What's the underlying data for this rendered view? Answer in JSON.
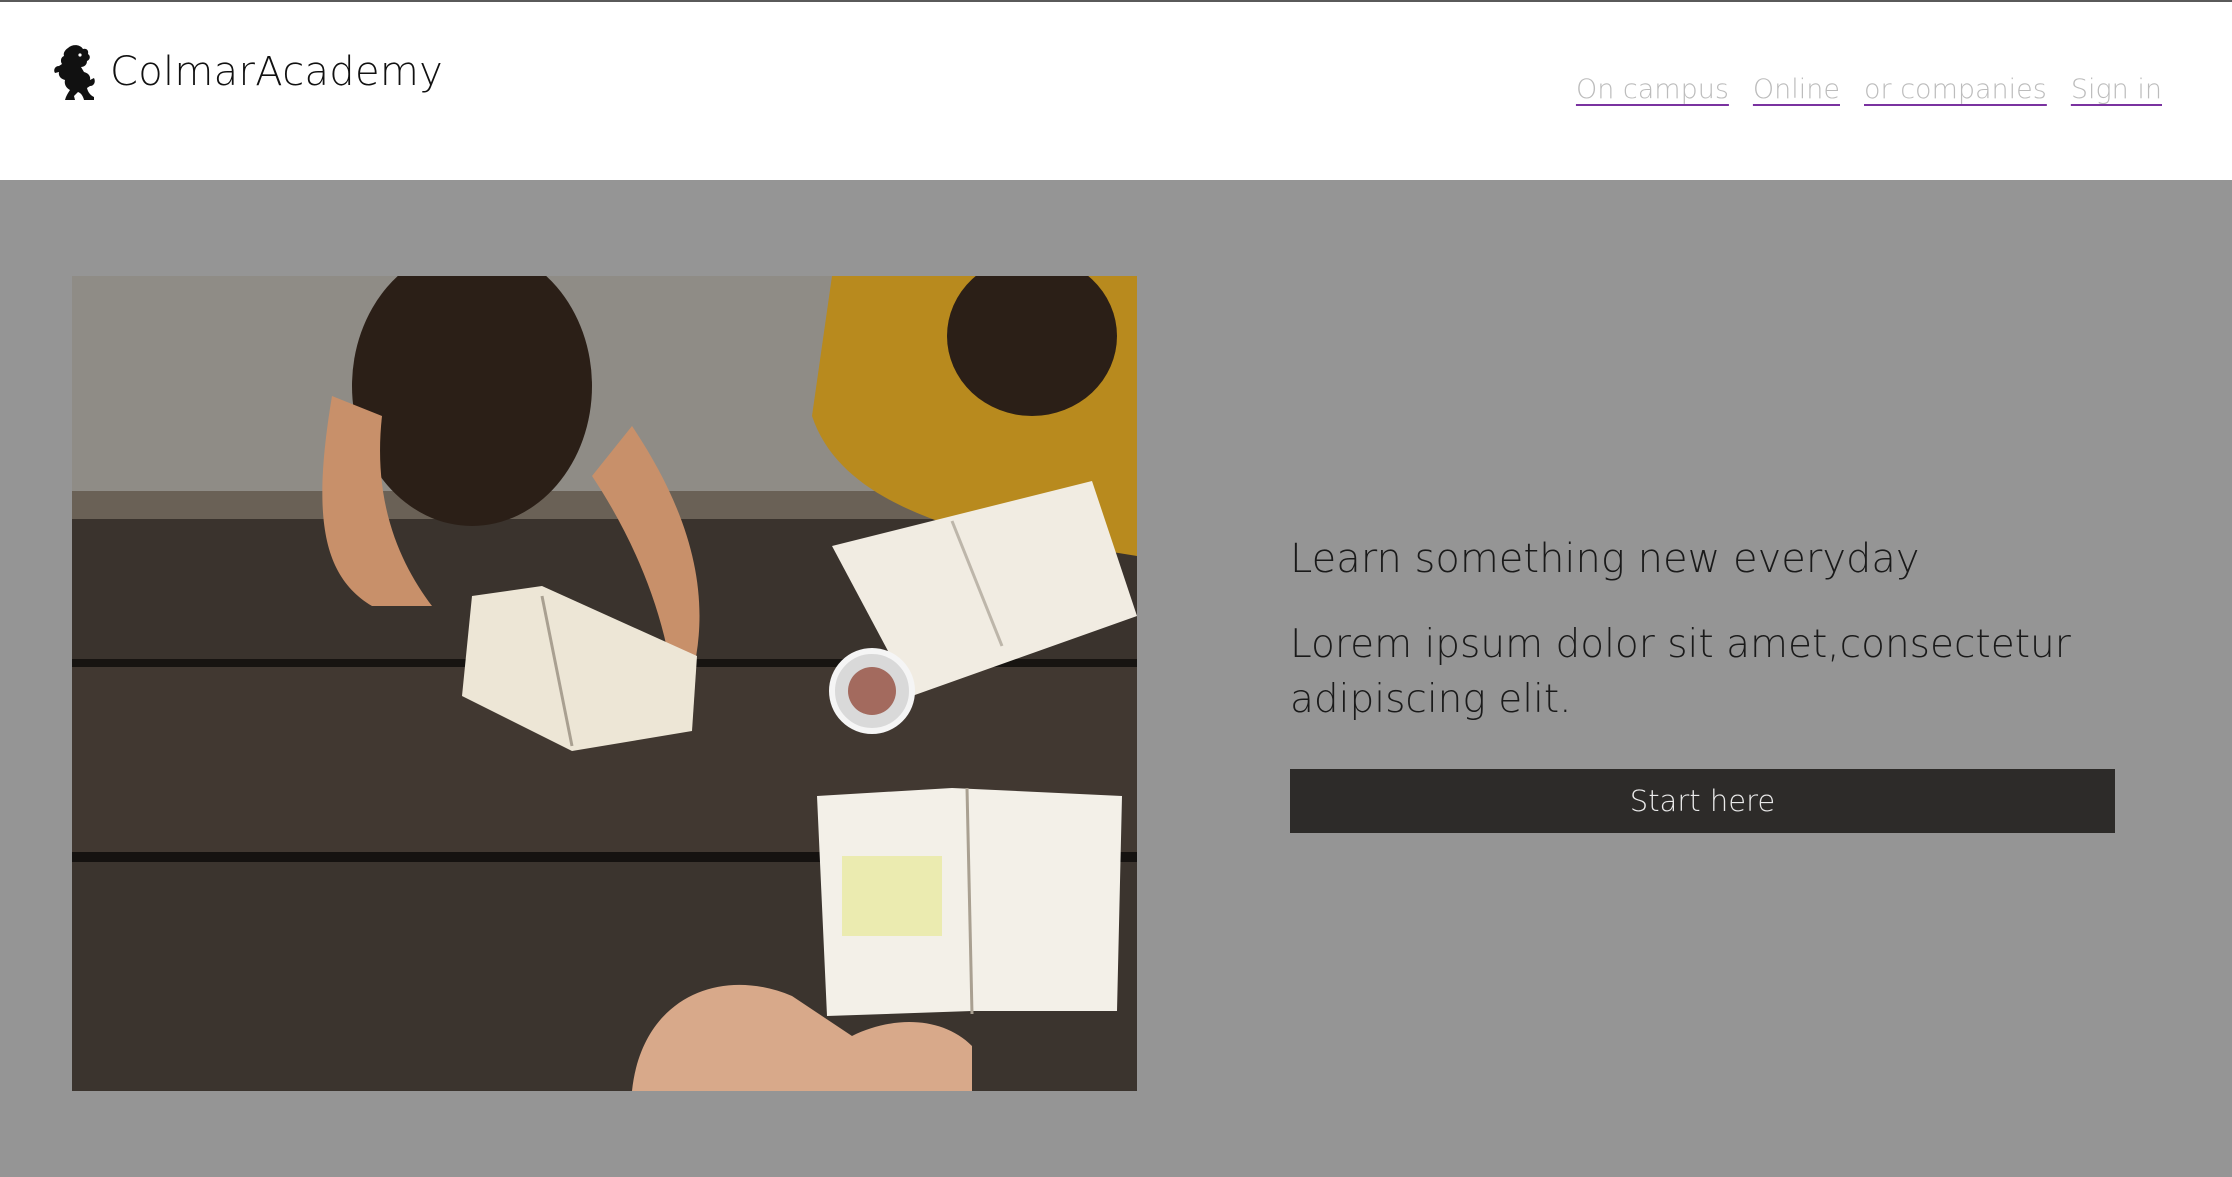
{
  "brand": {
    "name": "ColmarAcademy",
    "logo_icon": "lion-rampant-icon"
  },
  "nav": {
    "items": [
      {
        "label": "On campus"
      },
      {
        "label": "Online"
      },
      {
        "label": "or companies"
      },
      {
        "label": "Sign in"
      }
    ],
    "link_color": "#bcbcbc",
    "underline_color": "#7a32a0"
  },
  "hero": {
    "background_color": "#959595",
    "image_icon": "students-reading-photo",
    "headline": "Learn something new everyday",
    "body": "Lorem ipsum dolor sit amet,consectetur adipiscing elit.",
    "cta_label": "Start here",
    "cta_color": "#2d2b29"
  }
}
